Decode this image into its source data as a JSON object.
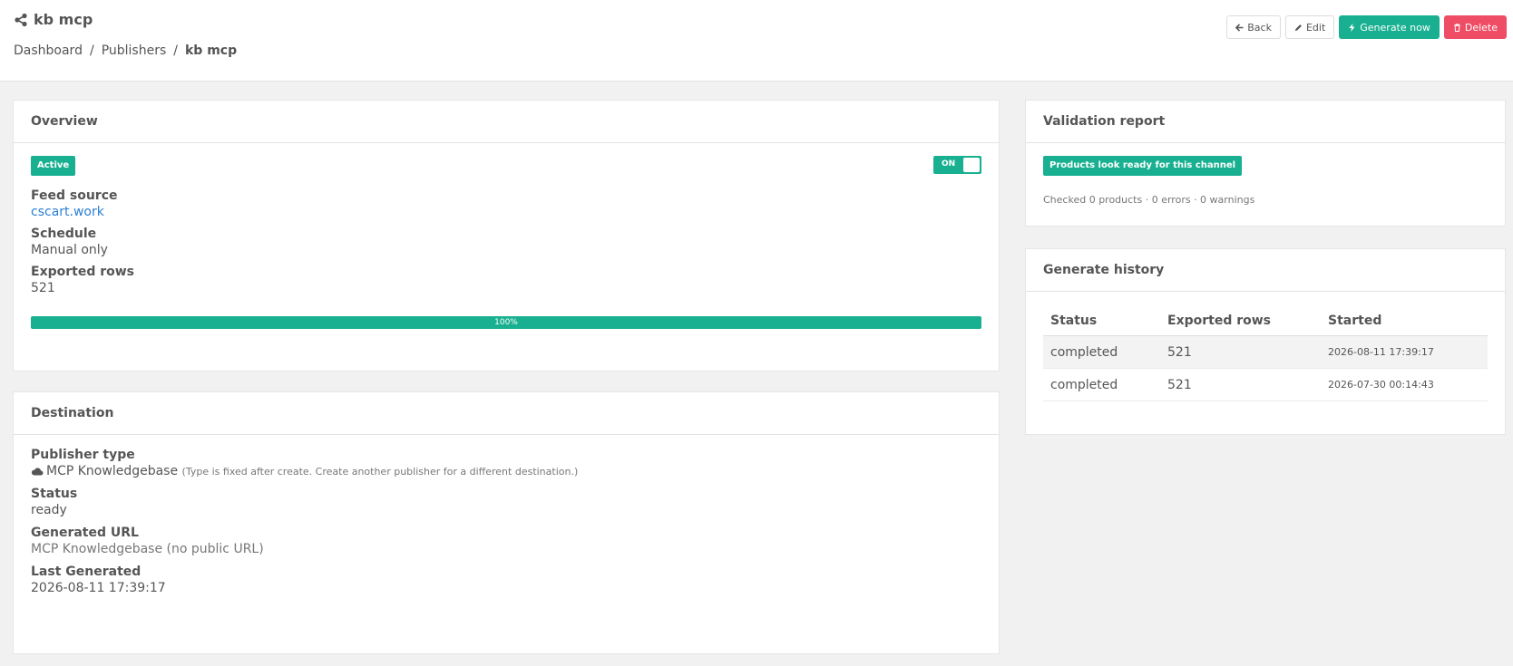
{
  "header": {
    "title": "kb mcp",
    "breadcrumb": [
      "Dashboard",
      "Publishers",
      "kb mcp"
    ],
    "separator": "/",
    "buttons": {
      "back": "Back",
      "edit": "Edit",
      "generate": "Generate now",
      "delete": "Delete"
    }
  },
  "overview": {
    "heading": "Overview",
    "status_badge": "Active",
    "toggle_label": "ON",
    "fields": [
      {
        "label": "Feed source",
        "value": "cscart.work"
      },
      {
        "label": "Schedule",
        "value": "Manual only"
      },
      {
        "label": "Exported rows",
        "value": "521"
      }
    ],
    "progress_percent": 100,
    "progress_label": "100%"
  },
  "destination": {
    "heading": "Destination",
    "publisher_type_label": "Publisher type",
    "publisher_type_value": "MCP Knowledgebase",
    "publisher_type_note": "(Type is fixed after create. Create another publisher for a different destination.)",
    "status_label": "Status",
    "status_value": "ready",
    "url_label": "Generated URL",
    "url_value": "MCP Knowledgebase (no public URL)",
    "last_label": "Last Generated",
    "last_value": "2026-08-11 17:39:17"
  },
  "validation": {
    "heading": "Validation report",
    "badge": "Products look ready for this channel",
    "summary": "Checked 0 products · 0 errors · 0 warnings"
  },
  "history": {
    "heading": "Generate history",
    "columns": [
      "Status",
      "Exported rows",
      "Started"
    ],
    "rows": [
      {
        "status": "completed",
        "rows": "521",
        "started": "2026-08-11 17:39:17"
      },
      {
        "status": "completed",
        "rows": "521",
        "started": "2026-07-30 00:14:43"
      }
    ]
  },
  "colors": {
    "accent": "#18b090",
    "danger": "#ee4d65",
    "link": "#2b7fd4"
  }
}
